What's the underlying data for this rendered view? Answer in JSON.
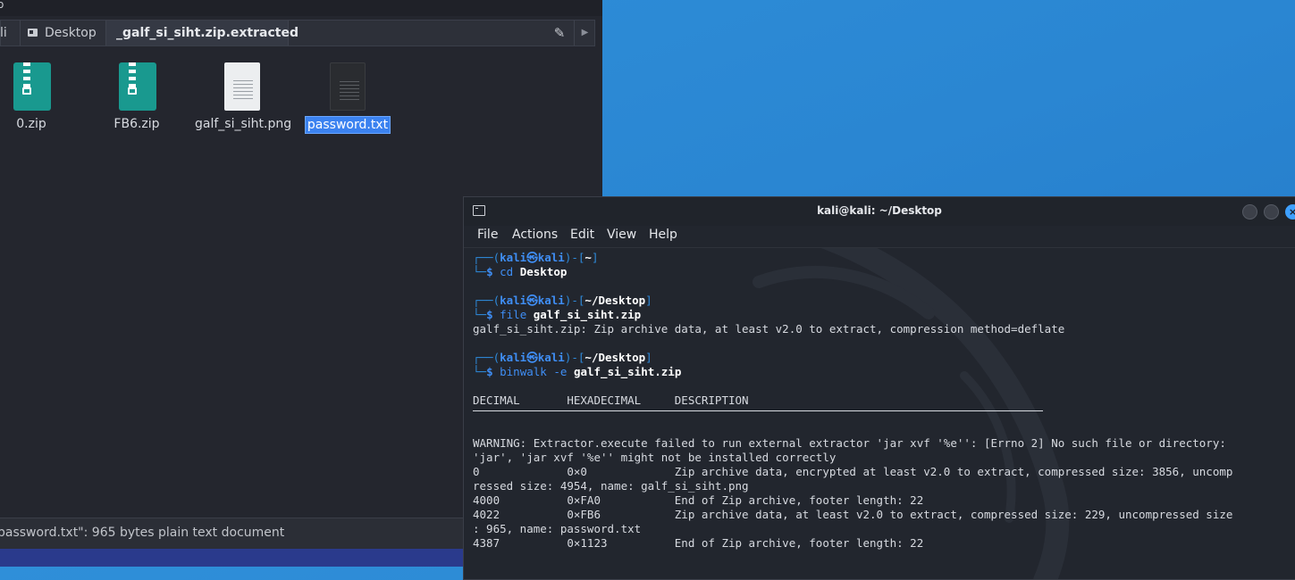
{
  "file_manager": {
    "title_fragment": "o",
    "breadcrumbs": [
      {
        "label": "li"
      },
      {
        "label": "Desktop"
      },
      {
        "label": "_galf_si_siht.zip.extracted"
      }
    ],
    "files": [
      {
        "name": "0.zip",
        "icon": "zip-archive-icon"
      },
      {
        "name": "FB6.zip",
        "icon": "zip-archive-icon"
      },
      {
        "name": "galf_si_siht.png",
        "icon": "image-document-icon"
      },
      {
        "name": "password.txt",
        "icon": "text-document-icon",
        "selected": true
      }
    ],
    "status": "password.txt\": 965 bytes plain text document"
  },
  "terminal": {
    "title": "kali@kali: ~/Desktop",
    "menu": [
      "File",
      "Actions",
      "Edit",
      "View",
      "Help"
    ],
    "lines": {
      "p1_user": "kali",
      "p1_host": "kali",
      "p1_dir": "~",
      "cmd1": "cd",
      "cmd1_arg": "Desktop",
      "p2_user": "kali",
      "p2_host": "kali",
      "p2_dir": "~/Desktop",
      "cmd2": "file",
      "cmd2_arg": "galf_si_siht.zip",
      "out2": "galf_si_siht.zip: Zip archive data, at least v2.0 to extract, compression method=deflate",
      "p3_user": "kali",
      "p3_host": "kali",
      "p3_dir": "~/Desktop",
      "cmd3": "binwalk",
      "cmd3_flag": "-e",
      "cmd3_arg": "galf_si_siht.zip",
      "header": "DECIMAL       HEXADECIMAL     DESCRIPTION",
      "warn1": "WARNING: Extractor.execute failed to run external extractor 'jar xvf '%e'': [Errno 2] No such file or directory:",
      "warn2": "'jar', 'jar xvf '%e'' might not be installed correctly",
      "r1": "0             0×0             Zip archive data, encrypted at least v2.0 to extract, compressed size: 3856, uncomp",
      "r1b": "ressed size: 4954, name: galf_si_siht.png",
      "r2": "4000          0×FA0           End of Zip archive, footer length: 22",
      "r3": "4022          0×FB6           Zip archive data, at least v2.0 to extract, compressed size: 229, uncompressed size",
      "r3b": ": 965, name: password.txt",
      "r4": "4387          0×1123          End of Zip archive, footer length: 22"
    }
  },
  "colors": {
    "desktop": "#2a86d2",
    "accent": "#3b82f0",
    "prompt": "#2e8bdc"
  }
}
